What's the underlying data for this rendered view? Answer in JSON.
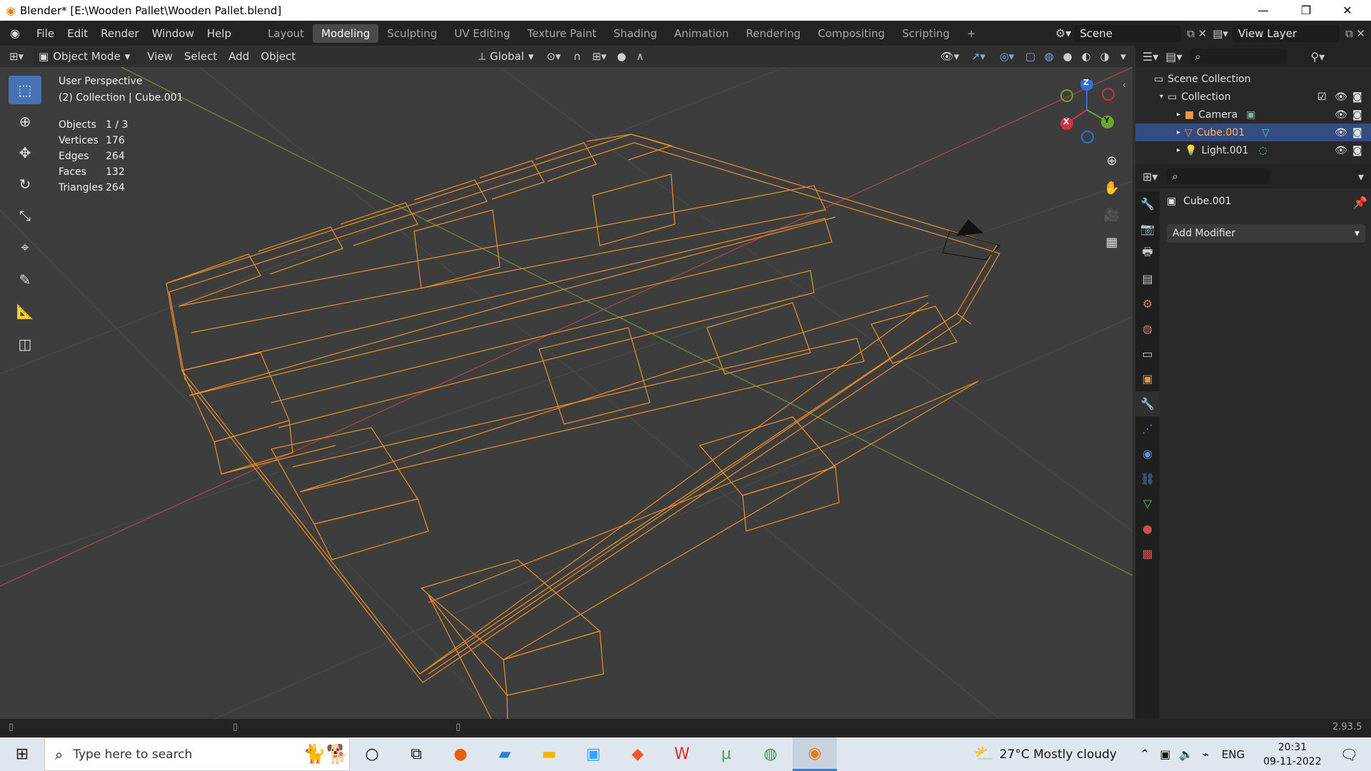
{
  "window": {
    "title": "Blender* [E:\\Wooden Pallet\\Wooden Pallet.blend]",
    "controls": {
      "minimize": "—",
      "maximize": "❐",
      "close": "✕"
    }
  },
  "menu": {
    "items": [
      "File",
      "Edit",
      "Render",
      "Window",
      "Help"
    ]
  },
  "workspaces": {
    "tabs": [
      "Layout",
      "Modeling",
      "Sculpting",
      "UV Editing",
      "Texture Paint",
      "Shading",
      "Animation",
      "Rendering",
      "Compositing",
      "Scripting"
    ],
    "active": "Modeling",
    "add_label": "+"
  },
  "scene": {
    "label": "Scene"
  },
  "view_layer": {
    "label": "View Layer"
  },
  "viewport_header": {
    "mode": "Object Mode",
    "menus": [
      "View",
      "Select",
      "Add",
      "Object"
    ],
    "transform_orientation": "Global"
  },
  "viewport": {
    "perspective": "User Perspective",
    "collection_info": "(2) Collection | Cube.001",
    "stats": [
      {
        "label": "Objects",
        "value": "1 / 3"
      },
      {
        "label": "Vertices",
        "value": "176"
      },
      {
        "label": "Edges",
        "value": "264"
      },
      {
        "label": "Faces",
        "value": "132"
      },
      {
        "label": "Triangles",
        "value": "264"
      }
    ],
    "gizmo": {
      "z": "Z",
      "y": "Y",
      "x": "X"
    },
    "wire_color": "#e9902c"
  },
  "outliner": {
    "root": "Scene Collection",
    "collection": "Collection",
    "items": [
      {
        "label": "Camera",
        "selected": false
      },
      {
        "label": "Cube.001",
        "selected": true
      },
      {
        "label": "Light.001",
        "selected": false
      }
    ]
  },
  "properties": {
    "object_name": "Cube.001",
    "add_modifier": "Add Modifier"
  },
  "statusbar": {
    "version": "2.93.5"
  },
  "taskbar": {
    "search_placeholder": "Type here to search",
    "weather": "27°C  Mostly cloudy",
    "language": "ENG",
    "time": "20:31",
    "date": "09-11-2022"
  },
  "colors": {
    "accent": "#4772b3",
    "selection": "#334d80",
    "wire": "#e9902c"
  }
}
